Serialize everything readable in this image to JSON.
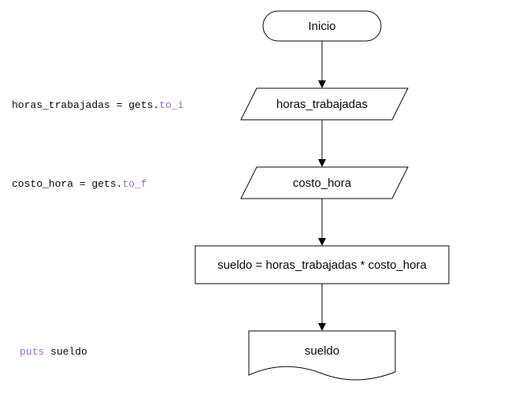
{
  "flowchart": {
    "start": {
      "label": "Inicio"
    },
    "input1": {
      "label": "horas_trabajadas"
    },
    "input2": {
      "label": "costo_hora"
    },
    "process": {
      "label": "sueldo = horas_trabajadas * costo_hora"
    },
    "output": {
      "label": "sueldo"
    }
  },
  "code": {
    "line1": {
      "plain": "horas_trabajadas = gets.",
      "accent": "to_i"
    },
    "line2": {
      "plain": "costo_hora = gets.",
      "accent": "to_f"
    },
    "line3": {
      "accent": "puts",
      "plain": " sueldo"
    }
  },
  "chart_data": {
    "type": "flowchart",
    "nodes": [
      {
        "id": "start",
        "kind": "terminator",
        "label": "Inicio"
      },
      {
        "id": "in1",
        "kind": "input",
        "label": "horas_trabajadas"
      },
      {
        "id": "in2",
        "kind": "input",
        "label": "costo_hora"
      },
      {
        "id": "proc",
        "kind": "process",
        "label": "sueldo = horas_trabajadas * costo_hora"
      },
      {
        "id": "out",
        "kind": "output",
        "label": "sueldo"
      }
    ],
    "edges": [
      {
        "from": "start",
        "to": "in1"
      },
      {
        "from": "in1",
        "to": "in2"
      },
      {
        "from": "in2",
        "to": "proc"
      },
      {
        "from": "proc",
        "to": "out"
      }
    ],
    "code_annotations": [
      "horas_trabajadas = gets.to_i",
      "costo_hora = gets.to_f",
      "puts sueldo"
    ]
  }
}
